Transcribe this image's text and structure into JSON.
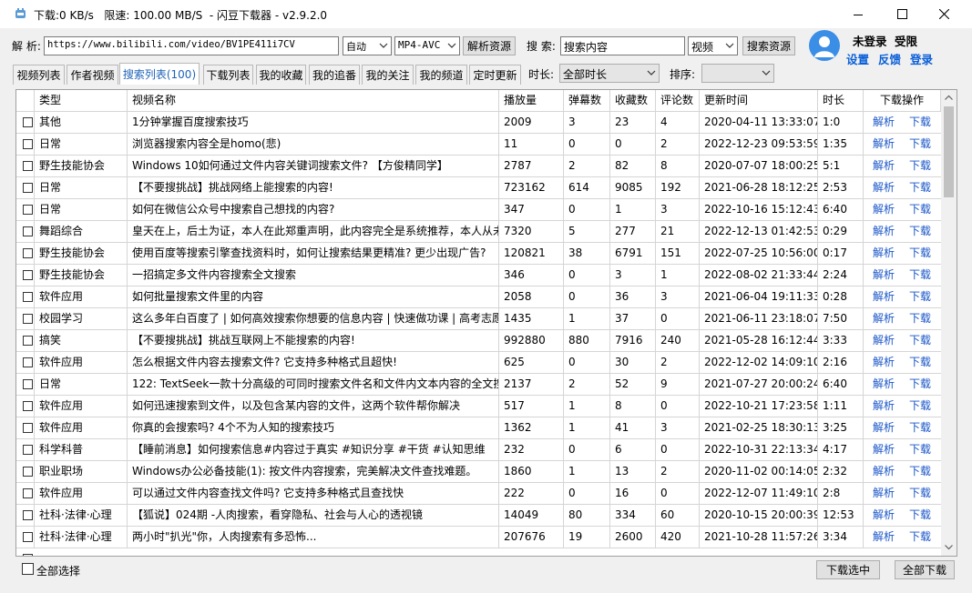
{
  "window": {
    "title": "下载:0 KB/s   限速: 100.00 MB/S  - 闪豆下载器 - v2.9.2.0"
  },
  "toolbar": {
    "parse_label": "解 析:",
    "url_value": "https://www.bilibili.com/video/BV1PE411i7CV",
    "mode_value": "自动",
    "format_value": "MP4-AVC",
    "parse_button": "解析资源",
    "search_label": "搜 索:",
    "search_value": "搜索内容",
    "search_type_value": "视频",
    "search_button": "搜索资源"
  },
  "user": {
    "status": "未登录",
    "limit": "受限",
    "settings_link": "设置",
    "feedback_link": "反馈",
    "login_link": "登录"
  },
  "tabs": [
    "视频列表",
    "作者视频",
    "搜索列表(100)",
    "下载列表",
    "我的收藏",
    "我的追番",
    "我的关注",
    "我的频道",
    "定时更新"
  ],
  "filters": {
    "duration_label": "时长:",
    "duration_value": "全部时长",
    "sort_label": "排序:",
    "sort_value": ""
  },
  "table": {
    "columns": [
      "类型",
      "视频名称",
      "播放量",
      "弹幕数",
      "收藏数",
      "评论数",
      "更新时间",
      "时长",
      "下载操作"
    ],
    "action_parse": "解析",
    "action_download": "下载",
    "rows": [
      [
        "其他",
        "1分钟掌握百度搜索技巧",
        "2009",
        "3",
        "23",
        "4",
        "2020-04-11 13:33:07",
        "1:0"
      ],
      [
        "日常",
        "浏览器搜索内容全是homo(悲)",
        "11",
        "0",
        "0",
        "2",
        "2022-12-23 09:53:59",
        "1:35"
      ],
      [
        "野生技能协会",
        "Windows 10如何通过文件内容关键词搜索文件? 【方俊精同学】",
        "2787",
        "2",
        "82",
        "8",
        "2020-07-07 18:00:25",
        "5:1"
      ],
      [
        "日常",
        "【不要搜挑战】挑战网络上能搜索的内容!",
        "723162",
        "614",
        "9085",
        "192",
        "2021-06-28 18:12:25",
        "2:53"
      ],
      [
        "日常",
        "如何在微信公众号中搜索自己想找的内容?",
        "347",
        "0",
        "1",
        "3",
        "2022-10-16 15:12:43",
        "6:40"
      ],
      [
        "舞蹈综合",
        "皇天在上，后土为证，本人在此郑重声明，此内容完全是系统推荐，本人从未搜索",
        "7320",
        "5",
        "277",
        "21",
        "2022-12-13 01:42:53",
        "0:29"
      ],
      [
        "野生技能协会",
        "使用百度等搜索引擎查找资料时，如何让搜索结果更精准? 更少出现广告?",
        "120821",
        "38",
        "6791",
        "151",
        "2022-07-25 10:56:00",
        "0:17"
      ],
      [
        "野生技能协会",
        "一招搞定多文件内容搜索全文搜索",
        "346",
        "0",
        "3",
        "1",
        "2022-08-02 21:33:44",
        "2:24"
      ],
      [
        "软件应用",
        "如何批量搜索文件里的内容",
        "2058",
        "0",
        "36",
        "3",
        "2021-06-04 19:11:33",
        "0:28"
      ],
      [
        "校园学习",
        "这么多年白百度了 | 如何高效搜索你想要的信息内容 | 快速做功课 | 高考志愿",
        "1435",
        "1",
        "37",
        "0",
        "2021-06-11 23:18:07",
        "7:50"
      ],
      [
        "搞笑",
        "【不要搜挑战】挑战互联网上不能搜索的内容!",
        "992880",
        "880",
        "7916",
        "240",
        "2021-05-28 16:12:44",
        "3:33"
      ],
      [
        "软件应用",
        "怎么根据文件内容去搜索文件? 它支持多种格式且超快!",
        "625",
        "0",
        "30",
        "2",
        "2022-12-02 14:09:10",
        "2:16"
      ],
      [
        "日常",
        "122: TextSeek一款十分高级的可同时搜索文件名和文件内文本内容的全文搜索",
        "2137",
        "2",
        "52",
        "9",
        "2021-07-27 20:00:24",
        "6:40"
      ],
      [
        "软件应用",
        "如何迅速搜索到文件，以及包含某内容的文件，这两个软件帮你解决",
        "517",
        "1",
        "8",
        "0",
        "2022-10-21 17:23:58",
        "1:11"
      ],
      [
        "软件应用",
        "你真的会搜索吗? 4个不为人知的搜索技巧",
        "1362",
        "1",
        "41",
        "3",
        "2021-02-25 18:30:13",
        "3:25"
      ],
      [
        "科学科普",
        "【睡前消息】如何搜索信息#内容过于真实 #知识分享 #干货 #认知思维",
        "232",
        "0",
        "6",
        "0",
        "2022-10-31 22:13:34",
        "4:17"
      ],
      [
        "职业职场",
        "Windows办公必备技能(1): 按文件内容搜索，完美解决文件查找难题。",
        "1860",
        "1",
        "13",
        "2",
        "2020-11-02 00:14:05",
        "2:32"
      ],
      [
        "软件应用",
        "可以通过文件内容查找文件吗? 它支持多种格式且查找快",
        "222",
        "0",
        "16",
        "0",
        "2022-12-07 11:49:10",
        "2:8"
      ],
      [
        "社科·法律·心理",
        "【狐说】024期 -人肉搜索，看穿隐私、社会与人心的透视镜",
        "14049",
        "80",
        "334",
        "60",
        "2020-10-15 20:00:39",
        "12:53"
      ],
      [
        "社科·法律·心理",
        "两小时\"扒光\"你，人肉搜索有多恐怖...",
        "207676",
        "19",
        "2600",
        "420",
        "2021-10-28 11:57:26",
        "3:34"
      ]
    ]
  },
  "footer": {
    "select_all": "全部选择",
    "download_selected": "下载选中",
    "download_all": "全部下载"
  }
}
